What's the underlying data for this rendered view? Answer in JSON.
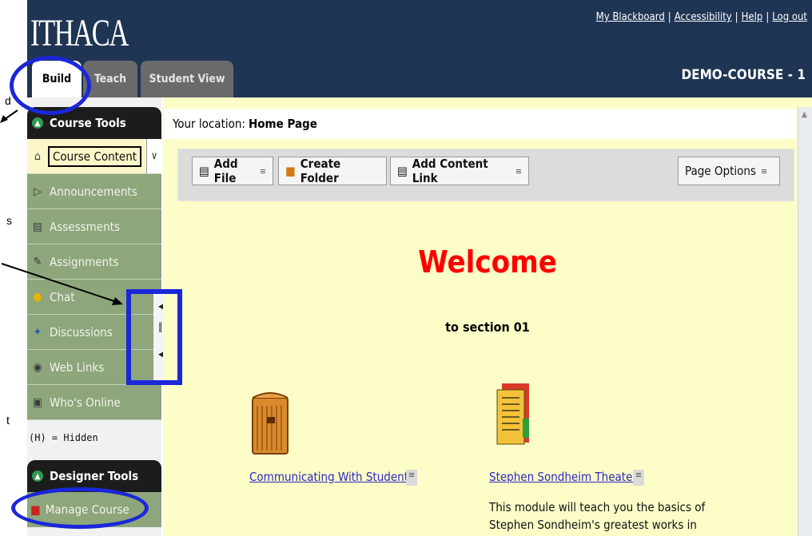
{
  "header": {
    "logo": "ITHACA",
    "links": [
      "My Blackboard",
      "Accessibility",
      "Help",
      "Log out"
    ],
    "course_title": "DEMO-COURSE - 1",
    "tabs": [
      "Build",
      "Teach",
      "Student View"
    ]
  },
  "sidebar": {
    "course_tools_title": "Course Tools",
    "items": [
      {
        "label": "Course Content",
        "icon": "home-icon"
      },
      {
        "label": "Announcements",
        "icon": "megaphone-icon"
      },
      {
        "label": "Assessments",
        "icon": "clipboard-icon"
      },
      {
        "label": "Assignments",
        "icon": "pencil-paper-icon"
      },
      {
        "label": "Chat",
        "icon": "speech-bubble-icon"
      },
      {
        "label": "Discussions",
        "icon": "pushpin-icon"
      },
      {
        "label": "Web Links",
        "icon": "globe-link-icon"
      },
      {
        "label": "Who's Online",
        "icon": "person-icon"
      }
    ],
    "hidden_note": "(H) = Hidden",
    "designer_tools_title": "Designer Tools",
    "manage_course": "Manage Course"
  },
  "main": {
    "location_label": "Your location:",
    "location_value": "Home Page",
    "toolbar": {
      "add_file": "Add File",
      "create_folder": "Create Folder",
      "add_content_link": "Add Content Link",
      "page_options": "Page Options"
    },
    "welcome": "Welcome",
    "subtitle": "to section 01",
    "items": [
      {
        "title": "Communicating With Students",
        "icon": "briefcase-icon"
      },
      {
        "title": "Stephen Sondheim Theater",
        "icon": "document-icon"
      }
    ],
    "description_line1": "This module will teach you the basics of",
    "description_line2": "Stephen Sondheim's greatest works in"
  },
  "annotations": {
    "clipped_text": [
      "d",
      "s",
      "t"
    ],
    "accent": "#1b27d8"
  }
}
